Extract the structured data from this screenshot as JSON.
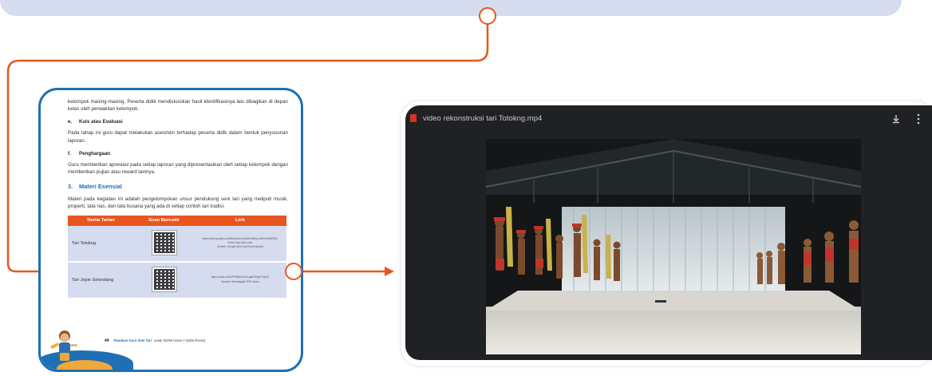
{
  "colors": {
    "accent": "#e8561f",
    "brand_blue": "#1f6fb4",
    "band": "#d5dcef",
    "viewer_bg": "#202124"
  },
  "book": {
    "intro_text": "kelompok masing-masing. Peserta didik mendiskusikan hasil identifikasinya lalu dibagikan di depan kelas oleh perwakilan kelompok.",
    "step_e": {
      "num": "e.",
      "title": "Kuis atau Evaluasi",
      "text": "Pada tahap ini guru dapat melakukan asesmen terhadap peserta didik dalam bentuk penyusunan laporan."
    },
    "step_f": {
      "num": "f.",
      "title": "Penghargaan",
      "text": "Guru memberikan apresiasi pada setiap laporan yang dipresentasikan oleh setiap kelompok dengan memberikan pujian atau reward lainnya."
    },
    "section_3": {
      "num": "3.",
      "title": "Materi Esensial",
      "text": "Materi pada kegiatan  ini adalah pengelompokan unsur pendukung seni tari yang meliputi musik, properti, tata rias, dan tata busana yang ada di setiap contoh tari tradisi."
    },
    "table": {
      "headers": [
        "Nama Tarian",
        "Scan Barcode",
        "Link"
      ],
      "rows": [
        {
          "name": "Tari Totokng",
          "link": "https://drive.google.com/file/d/1wXnqXoBeYoBIyy-2wKhDsMDSEd-f/view?usp=drive_link",
          "source": "Sumber: Google Drive Dwi Nurul Istonika"
        },
        {
          "name": "Tari Jepin Selendang",
          "link": "https://youtu.be/1kPFt2MnoK?si=qaM3SqcPOqYrG",
          "source": "Sumber: Sendratasik PKIP Untan"
        }
      ]
    },
    "footer": {
      "page_number": "44",
      "title": "Panduan Guru Seni Tari",
      "subtitle": "untuk SD/MI Kelas V (Edisi Revisi)"
    }
  },
  "viewer": {
    "file_icon": "video-file-icon",
    "file_name": "video rekonstruksi tari Totokng.mp4",
    "download_icon": "download-icon",
    "more_icon": "more-vert-icon"
  }
}
